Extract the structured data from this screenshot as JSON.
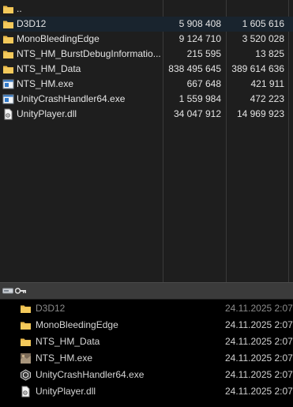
{
  "top_panel": {
    "rows": [
      {
        "name": "..",
        "size": "",
        "packed": "",
        "icon": "folder-up-icon",
        "selected": false
      },
      {
        "name": "D3D12",
        "size": "5 908 408",
        "packed": "1 605 616",
        "icon": "folder-icon",
        "selected": true
      },
      {
        "name": "MonoBleedingEdge",
        "size": "9 124 710",
        "packed": "3 520 028",
        "icon": "folder-icon",
        "selected": false
      },
      {
        "name": "NTS_HM_BurstDebugInformatio...",
        "size": "215 595",
        "packed": "13 825",
        "icon": "folder-icon",
        "selected": false
      },
      {
        "name": "NTS_HM_Data",
        "size": "838 495 645",
        "packed": "389 614 636",
        "icon": "folder-icon",
        "selected": false
      },
      {
        "name": "NTS_HM.exe",
        "size": "667 648",
        "packed": "421 911",
        "icon": "exe-icon",
        "selected": false
      },
      {
        "name": "UnityCrashHandler64.exe",
        "size": "1 559 984",
        "packed": "472 223",
        "icon": "exe-icon",
        "selected": false
      },
      {
        "name": "UnityPlayer.dll",
        "size": "34 047 912",
        "packed": "14 969 923",
        "icon": "dll-icon",
        "selected": false
      }
    ]
  },
  "bottom_panel": {
    "rows": [
      {
        "name": "D3D12",
        "date": "24.11.2025 2:07",
        "icon": "folder-icon",
        "dim": true
      },
      {
        "name": "MonoBleedingEdge",
        "date": "24.11.2025 2:07",
        "icon": "folder-icon",
        "dim": false
      },
      {
        "name": "NTS_HM_Data",
        "date": "24.11.2025 2:07",
        "icon": "folder-icon",
        "dim": false
      },
      {
        "name": "NTS_HM.exe",
        "date": "24.11.2025 2:07",
        "icon": "game-exe-icon",
        "dim": false
      },
      {
        "name": "UnityCrashHandler64.exe",
        "date": "24.11.2025 2:07",
        "icon": "unity-exe-icon",
        "dim": false
      },
      {
        "name": "UnityPlayer.dll",
        "date": "24.11.2025 2:07",
        "icon": "dll-icon",
        "dim": false
      }
    ]
  },
  "colors": {
    "folder": "#e8b84a",
    "selected_row": "#19242e",
    "top_background": "#1e1e1e",
    "bottom_background": "#000000"
  }
}
